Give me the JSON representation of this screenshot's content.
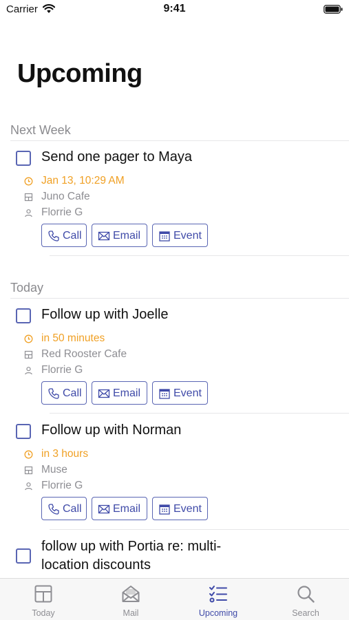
{
  "status_bar": {
    "carrier": "Carrier",
    "time": "9:41"
  },
  "page_title": "Upcoming",
  "sections": [
    {
      "header": "Next Week",
      "items": [
        {
          "title": "Send one pager to Maya",
          "due": "Jan 13, 10:29 AM",
          "location": "Juno Cafe",
          "person": "Florrie G",
          "actions": [
            "Call",
            "Email",
            "Event"
          ]
        }
      ]
    },
    {
      "header": "Today",
      "items": [
        {
          "title": "Follow up with Joelle",
          "due": "in 50 minutes",
          "location": "Red Rooster Cafe",
          "person": "Florrie G",
          "actions": [
            "Call",
            "Email",
            "Event"
          ]
        },
        {
          "title": "Follow up with Norman",
          "due": "in 3 hours",
          "location": "Muse",
          "person": "Florrie G",
          "actions": [
            "Call",
            "Email",
            "Event"
          ]
        },
        {
          "title_line1": "follow up with Portia re: multi-",
          "title_line2": "location discounts"
        }
      ]
    }
  ],
  "tab_bar": {
    "tabs": [
      {
        "label": "Today",
        "icon": "calendar-grid-icon"
      },
      {
        "label": "Mail",
        "icon": "mail-icon"
      },
      {
        "label": "Upcoming",
        "icon": "checklist-icon",
        "active": true
      },
      {
        "label": "Search",
        "icon": "search-icon"
      }
    ]
  },
  "colors": {
    "accent": "#3f4aa8",
    "due": "#f0a024",
    "secondary_text": "#8e8e93"
  }
}
